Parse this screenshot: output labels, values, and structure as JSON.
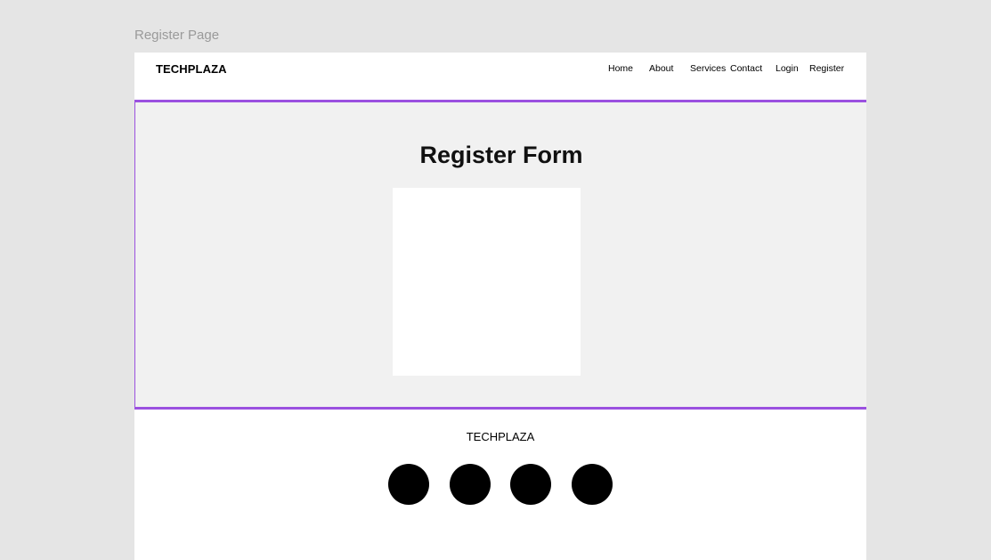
{
  "frame_label": "Register Page",
  "navbar": {
    "brand": "TECHPLAZA",
    "links": [
      "Home",
      "About",
      "Services",
      "Contact",
      "Login",
      "Register"
    ]
  },
  "hero": {
    "title": "Register Form"
  },
  "footer": {
    "brand": "TECHPLAZA",
    "social_icons": [
      "social-icon-1",
      "social-icon-2",
      "social-icon-3",
      "social-icon-4"
    ]
  },
  "colors": {
    "canvas": "#e5e5e5",
    "page": "#ffffff",
    "hero_bg": "#f1f1f1",
    "selection_border": "#9b51e0",
    "social_icon": "#000000"
  }
}
